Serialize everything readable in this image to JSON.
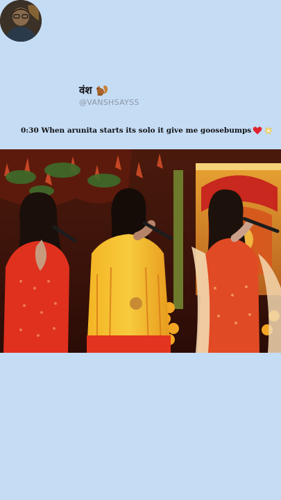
{
  "post": {
    "display_name": "वंश",
    "handle": "@VANSHSAYSS",
    "text": "0:30 When arunita starts its solo it give me goosebumps",
    "name_emoji_icon": "squirrel-icon",
    "text_emoji_icons": [
      "red-heart-icon",
      "collision-spark-icon"
    ]
  },
  "video": {
    "content": "three-singers-stage-performance-photo"
  },
  "colors": {
    "background": "#c5dcf5",
    "name_text": "#111111",
    "handle_text": "#8b96a4",
    "heart": "#e0242f"
  }
}
